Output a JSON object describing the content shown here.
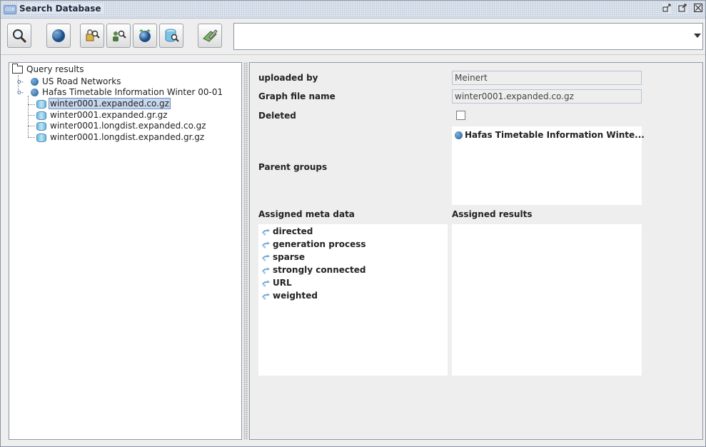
{
  "window": {
    "title": "Search Database",
    "app_badge": "GDB",
    "controls": [
      "minimize",
      "maximize",
      "close"
    ]
  },
  "toolbar": {
    "buttons": [
      {
        "icon": "search-icon"
      },
      {
        "icon": "globe-icon"
      },
      {
        "icon": "lock-search-icon"
      },
      {
        "icon": "search-people-icon"
      },
      {
        "icon": "globe-refresh-icon"
      },
      {
        "icon": "database-search-icon"
      },
      {
        "icon": "edit-icon"
      }
    ],
    "query_value": ""
  },
  "tree": {
    "root": "Query results",
    "items": [
      {
        "label": "US Road Networks",
        "type": "group",
        "expanded": false
      },
      {
        "label": "Hafas Timetable Information Winter 00-01",
        "type": "group",
        "expanded": true
      },
      {
        "label": "winter0001.expanded.co.gz",
        "type": "file",
        "selected": true
      },
      {
        "label": "winter0001.expanded.gr.gz",
        "type": "file"
      },
      {
        "label": "winter0001.longdist.expanded.co.gz",
        "type": "file"
      },
      {
        "label": "winter0001.longdist.expanded.gr.gz",
        "type": "file"
      }
    ]
  },
  "detail": {
    "uploaded_by_label": "uploaded by",
    "uploaded_by_value": "Meinert",
    "graph_file_label": "Graph file name",
    "graph_file_value": "winter0001.expanded.co.gz",
    "deleted_label": "Deleted",
    "deleted_checked": false,
    "parent_groups_label": "Parent groups",
    "parent_groups": [
      "Hafas Timetable Information Winte..."
    ],
    "assigned_meta_label": "Assigned meta data",
    "assigned_meta": [
      "directed",
      "generation process",
      "sparse",
      "strongly connected",
      "URL",
      "weighted"
    ],
    "assigned_results_label": "Assigned results",
    "assigned_results": []
  }
}
